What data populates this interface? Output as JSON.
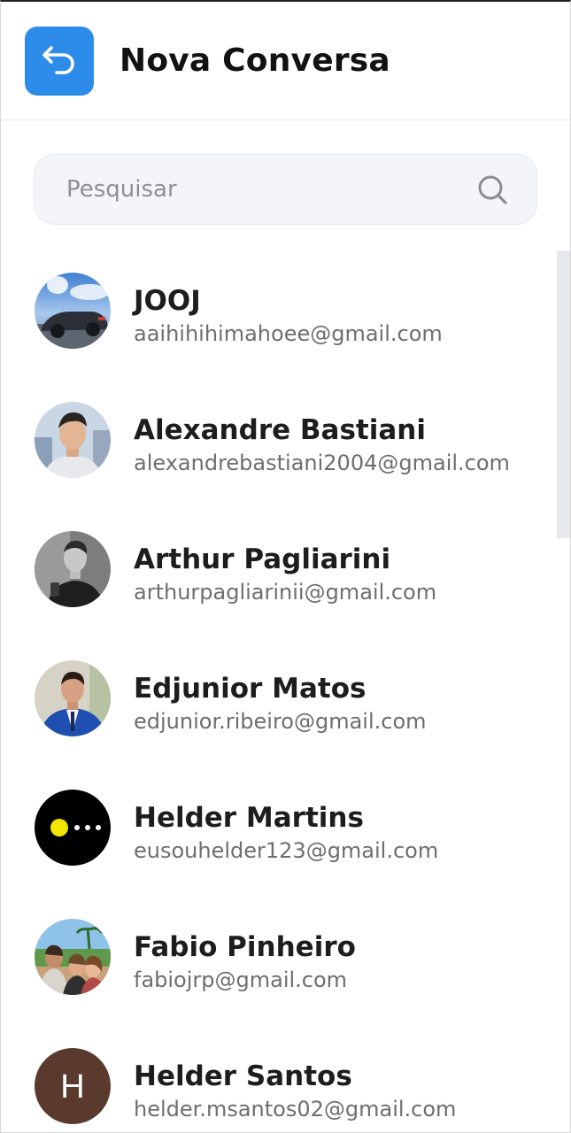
{
  "header": {
    "title": "Nova Conversa"
  },
  "search": {
    "placeholder": "Pesquisar",
    "value": ""
  },
  "contacts": [
    {
      "name": "JOOJ",
      "email": "aaihihihimahoee@gmail.com",
      "avatar": "photo-car"
    },
    {
      "name": "Alexandre Bastiani",
      "email": "alexandrebastiani2004@gmail.com",
      "avatar": "photo-person"
    },
    {
      "name": "Arthur Pagliarini",
      "email": "arthurpagliarinii@gmail.com",
      "avatar": "photo-person-bw"
    },
    {
      "name": "Edjunior Matos",
      "email": "edjunior.ribeiro@gmail.com",
      "avatar": "photo-person-suit"
    },
    {
      "name": "Helder Martins",
      "email": "eusouhelder123@gmail.com",
      "avatar": "pacman-icon"
    },
    {
      "name": "Fabio Pinheiro",
      "email": "fabiojrp@gmail.com",
      "avatar": "photo-group"
    },
    {
      "name": "Helder Santos",
      "email": "helder.msantos02@gmail.com",
      "avatar": "initial-avatar",
      "initial": "H"
    }
  ],
  "colors": {
    "accent": "#2d8cea",
    "search_bg": "#f3f5f8",
    "initial_avatar_bg": "#5a3a2c"
  }
}
